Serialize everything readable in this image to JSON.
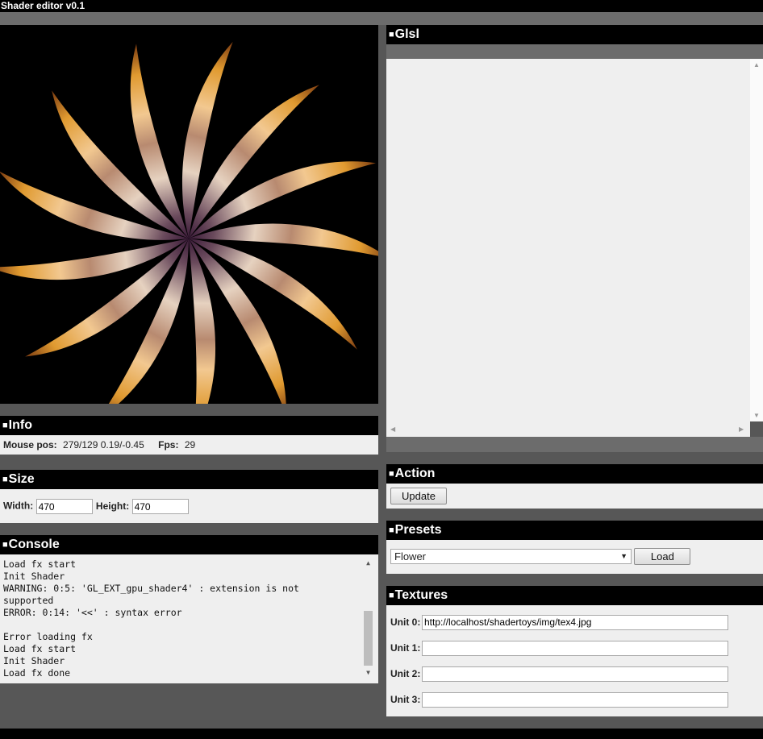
{
  "app": {
    "title": "Shader editor v0.1"
  },
  "panels": {
    "info": {
      "title": "Info",
      "mouse_label": "Mouse pos:",
      "mouse_value": "279/129 0.19/-0.45",
      "fps_label": "Fps:",
      "fps_value": "29"
    },
    "size": {
      "title": "Size",
      "width_label": "Width:",
      "width_value": "470",
      "height_label": "Height:",
      "height_value": "470"
    },
    "console": {
      "title": "Console",
      "lines": [
        "Load fx start",
        "Init Shader",
        "WARNING: 0:5: 'GL_EXT_gpu_shader4' : extension is not supported",
        "ERROR: 0:14: '<<' : syntax error",
        "",
        "Error loading fx",
        "Load fx start",
        "Init Shader",
        "Load fx done"
      ]
    },
    "glsl": {
      "title": "Glsl",
      "code": ""
    },
    "action": {
      "title": "Action",
      "update_label": "Update"
    },
    "presets": {
      "title": "Presets",
      "selected": "Flower",
      "load_label": "Load"
    },
    "textures": {
      "title": "Textures",
      "units": [
        {
          "label": "Unit 0:",
          "value": "http://localhost/shadertoys/img/tex4.jpg"
        },
        {
          "label": "Unit 1:",
          "value": ""
        },
        {
          "label": "Unit 2:",
          "value": ""
        },
        {
          "label": "Unit 3:",
          "value": ""
        }
      ]
    }
  },
  "shader_preview": {
    "petal_count": 13,
    "colors": {
      "amber": "#e8a030",
      "cream": "#f0d8c0",
      "purple": "#4a2040",
      "background": "#000000"
    }
  },
  "icons": {
    "header_marker": "black-square",
    "scroll_up": "up-triangle",
    "scroll_down": "down-triangle",
    "dropdown": "down-triangle"
  }
}
